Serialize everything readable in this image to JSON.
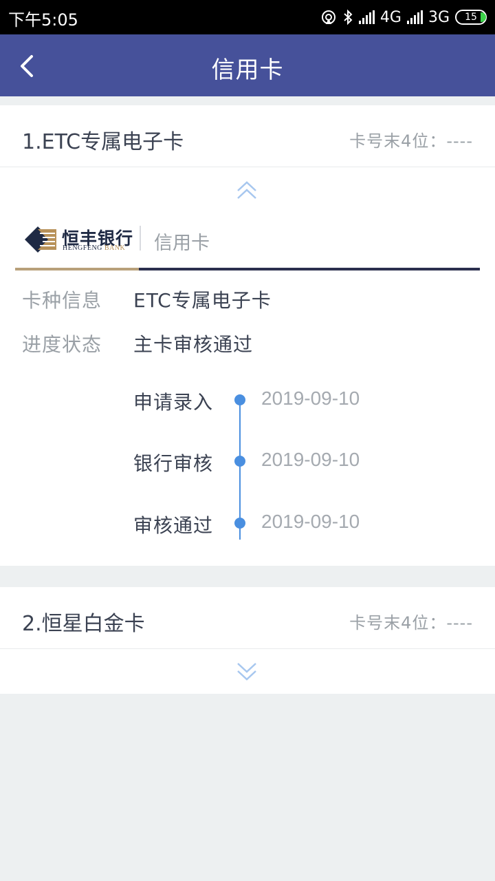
{
  "status_bar": {
    "time": "下午5:05",
    "network1": "4G",
    "network2": "3G",
    "battery": "15"
  },
  "nav": {
    "title": "信用卡",
    "back_icon": "chevron-left-icon"
  },
  "cards": [
    {
      "title": "1.ETC专属电子卡",
      "tail_label": "卡号末4位：----",
      "expanded": true,
      "bank_name": "恒丰银行",
      "bank_name_en_1": "HENGFENG",
      "bank_name_en_2": "BANK",
      "card_type": "信用卡",
      "info": [
        {
          "label": "卡种信息",
          "value": "ETC专属电子卡"
        },
        {
          "label": "进度状态",
          "value": "主卡审核通过"
        }
      ],
      "timeline": [
        {
          "label": "申请录入",
          "date": "2019-09-10"
        },
        {
          "label": "银行审核",
          "date": "2019-09-10"
        },
        {
          "label": "审核通过",
          "date": "2019-09-10"
        }
      ]
    },
    {
      "title": "2.恒星白金卡",
      "tail_label": "卡号末4位：----",
      "expanded": false
    }
  ],
  "colors": {
    "nav_bg": "#46519a",
    "timeline": "#4a8fe0",
    "accent_gold": "#b8a07a"
  }
}
